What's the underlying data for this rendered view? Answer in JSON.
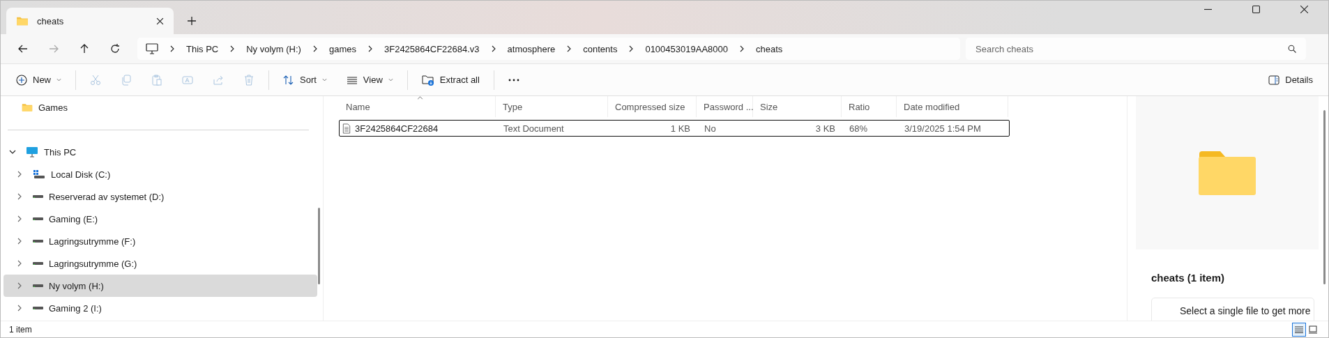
{
  "tab": {
    "title": "cheats",
    "selected": true
  },
  "breadcrumb": [
    "This PC",
    "Ny volym (H:)",
    "games",
    "3F2425864CF22684.v3",
    "atmosphere",
    "contents",
    "0100453019AA8000",
    "cheats"
  ],
  "search": {
    "placeholder": "Search cheats"
  },
  "toolbar": [
    {
      "kind": "new",
      "label": "New",
      "disabled": false
    },
    {
      "kind": "cut",
      "disabled": true
    },
    {
      "kind": "copy",
      "disabled": true
    },
    {
      "kind": "paste",
      "disabled": true
    },
    {
      "kind": "rename",
      "disabled": true
    },
    {
      "kind": "share",
      "disabled": true
    },
    {
      "kind": "delete",
      "disabled": true
    },
    {
      "kind": "sort",
      "label": "Sort",
      "disabled": false
    },
    {
      "kind": "view",
      "label": "View",
      "disabled": false
    },
    {
      "kind": "extract",
      "label": "Extract all",
      "disabled": false
    },
    {
      "kind": "more",
      "disabled": false
    }
  ],
  "details_button": {
    "label": "Details"
  },
  "sidebar": {
    "pinned": [
      {
        "label": "Games",
        "selected": false
      }
    ],
    "tree": [
      {
        "label": "This PC",
        "expanded": true,
        "selected": false,
        "children": [
          {
            "kind": "system",
            "label": "Local Disk (C:)",
            "selected": false
          },
          {
            "kind": "drive",
            "label": "Reserverad av systemet (D:)",
            "selected": false
          },
          {
            "kind": "drive",
            "label": "Gaming (E:)",
            "selected": false
          },
          {
            "kind": "drive",
            "label": "Lagringsutrymme (F:)",
            "selected": false
          },
          {
            "kind": "drive",
            "label": "Lagringsutrymme (G:)",
            "selected": false
          },
          {
            "kind": "drive",
            "label": "Ny volym (H:)",
            "selected": true
          },
          {
            "kind": "drive",
            "label": "Gaming 2 (I:)",
            "selected": false
          }
        ]
      }
    ]
  },
  "table": {
    "columns": [
      {
        "label": "Name",
        "sorted": true
      },
      {
        "label": "Type",
        "sorted": false
      },
      {
        "label": "Compressed size",
        "sorted": false
      },
      {
        "label": "Password ...",
        "sorted": false
      },
      {
        "label": "Size",
        "sorted": false
      },
      {
        "label": "Ratio",
        "sorted": false
      },
      {
        "label": "Date modified",
        "sorted": false
      }
    ],
    "rows": [
      {
        "selected": true,
        "cells": [
          "3F2425864CF22684",
          "Text Document",
          "1 KB",
          "No",
          "3 KB",
          "68%",
          "3/19/2025 1:54 PM"
        ]
      }
    ]
  },
  "details": {
    "title": "cheats (1 item)",
    "info": "Select a single file to get more"
  },
  "status_bar": {
    "text": "1 item",
    "view_modes": [
      {
        "selected": true
      },
      {
        "selected": false
      }
    ]
  }
}
